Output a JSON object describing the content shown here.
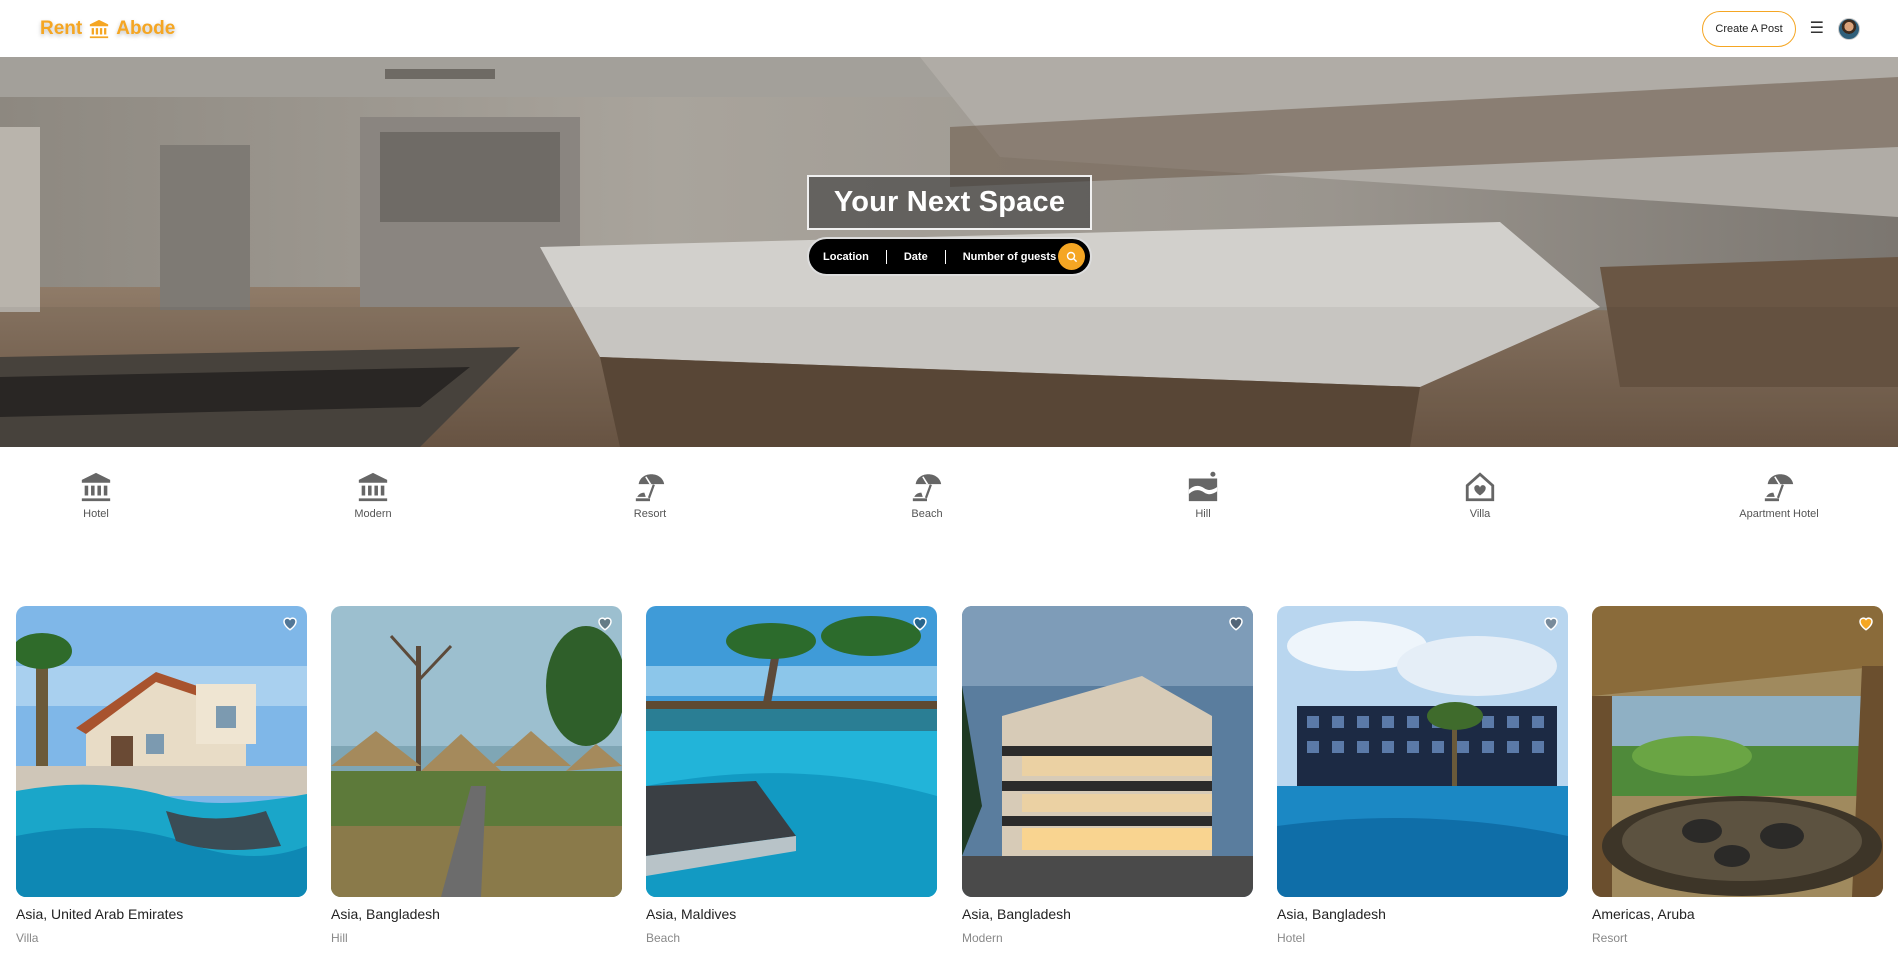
{
  "header": {
    "logo_left": "Rent",
    "logo_right": "Abode",
    "logo_icon": "bank-icon",
    "create_post_label": "Create A Post",
    "menu_icon": "hamburger-icon",
    "brand_color": "#f5a623"
  },
  "hero": {
    "title": "Your Next Space",
    "search": {
      "location": "Location",
      "date": "Date",
      "guests": "Number of guests",
      "button_icon": "search-icon"
    }
  },
  "categories": [
    {
      "label": "Hotel",
      "icon": "bank-icon"
    },
    {
      "label": "Modern",
      "icon": "bank-icon"
    },
    {
      "label": "Resort",
      "icon": "beach-umbrella-icon"
    },
    {
      "label": "Beach",
      "icon": "beach-umbrella-icon"
    },
    {
      "label": "Hill",
      "icon": "hill-icon"
    },
    {
      "label": "Villa",
      "icon": "house-heart-icon"
    },
    {
      "label": "Apartment Hotel",
      "icon": "beach-umbrella-icon"
    }
  ],
  "listings": [
    {
      "location": "Asia, United Arab Emirates",
      "type": "Villa",
      "favorited": false
    },
    {
      "location": "Asia, Bangladesh",
      "type": "Hill",
      "favorited": false
    },
    {
      "location": "Asia, Maldives",
      "type": "Beach",
      "favorited": false
    },
    {
      "location": "Asia, Bangladesh",
      "type": "Modern",
      "favorited": false
    },
    {
      "location": "Asia, Bangladesh",
      "type": "Hotel",
      "favorited": false
    },
    {
      "location": "Americas, Aruba",
      "type": "Resort",
      "favorited": true
    }
  ]
}
